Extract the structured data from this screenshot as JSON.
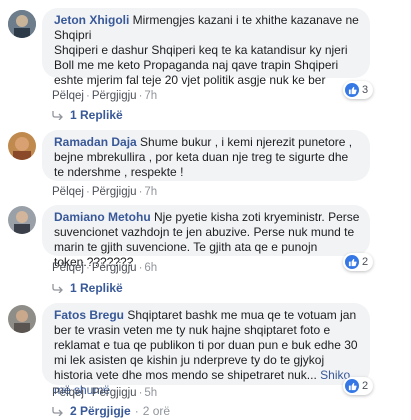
{
  "comments": [
    {
      "author": "Jeton Xhigoli",
      "text": " Mirmengjes kazani i te xhithe kazanave ne Shqipri\nShqiperi e dashur Shqiperi keq te ka katandisur ky njeri\nBoll me me keto Propaganda naj qave trapin Shqiperi eshte mjerim fal teje 20 vjet politik asgje nuk ke ber",
      "like": "Pëlqej",
      "reply": "Përgjigju",
      "time": "7h",
      "reactions": "3",
      "replies_label": "1 Replikë"
    },
    {
      "author": "Ramadan Daja",
      "text": " Shume bukur , i kemi njerezit punetore , bejne mbrekullira , por keta duan nje treg te sigurte dhe te ndershme , respekte !",
      "like": "Pëlqej",
      "reply": "Përgjigju",
      "time": "7h"
    },
    {
      "author": "Damiano Metohu",
      "text": " Nje pyetie kisha zoti kryeministr. Perse suvencionet vazhdojn te jen abuzive. Perse nuk mund te marin te gjith suvencione. Te gjith ata qe e punojn token.???????",
      "like": "Pëlqej",
      "reply": "Përgjigju",
      "time": "6h",
      "reactions": "2",
      "replies_label": "1 Replikë"
    },
    {
      "author": "Fatos Bregu",
      "text": " Shqiptaret bashk me mua qe te votuam jan ber te vrasin veten me ty nuk hajne shqiptaret foto e reklamat e tua qe publikon ti por duan pun e buk edhe 30 mi lek asisten qe kishin ju nderpreve ty do te gjykoj historia vete dhe mos mendo se shipetraret nuk...",
      "see_more": "Shiko më shumë",
      "like": "Pëlqej",
      "reply": "Përgjigju",
      "time": "5h",
      "reactions": "2",
      "replies_label": "2 Përgjigje",
      "replies_time": "2 orë"
    }
  ],
  "colors": {
    "link": "#385898",
    "bubble": "#f2f3f5",
    "like": "#3578e5"
  }
}
